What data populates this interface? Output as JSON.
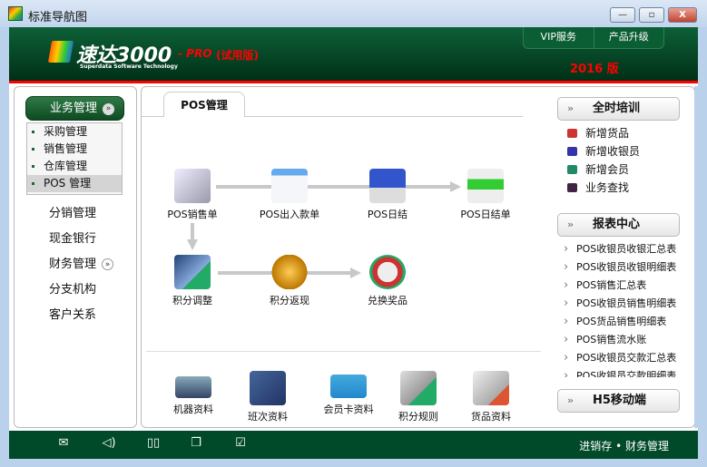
{
  "window": {
    "title": "标准导航图",
    "min": "—",
    "max": "▫",
    "close": "X"
  },
  "header": {
    "logo": "速达3000",
    "logo_sub": "Superdata Software Technology",
    "pro": "- PRO",
    "trial": "(试用版)",
    "vip": "VIP服务",
    "upgrade": "产品升级",
    "year": "2016 版"
  },
  "left": {
    "active": "业务管理",
    "sub": [
      "采购管理",
      "销售管理",
      "仓库管理",
      "POS 管理"
    ],
    "items": [
      "分销管理",
      "现金银行",
      "财务管理",
      "分支机构",
      "客户关系"
    ]
  },
  "main": {
    "tab": "POS管理",
    "flow_row1": [
      "POS销售单",
      "POS出入款单",
      "POS日结",
      "POS日结单"
    ],
    "flow_row2": [
      "积分调整",
      "积分返现",
      "兑换奖品"
    ],
    "bottom": [
      "机器资料",
      "班次资料",
      "会员卡资料",
      "积分规则",
      "货品资料"
    ]
  },
  "right": {
    "training": "全时培训",
    "quick": [
      "新增货品",
      "新增收银员",
      "新增会员",
      "业务查找"
    ],
    "reports_title": "报表中心",
    "reports": [
      "POS收银员收银汇总表",
      "POS收银员收银明细表",
      "POS销售汇总表",
      "POS收银员销售明细表",
      "POS货品销售明细表",
      "POS销售流水账",
      "POS收银员交款汇总表",
      "POS收银员交款明细表"
    ],
    "h5": "H5移动端"
  },
  "footer": {
    "text": "进销存 • 财务管理"
  },
  "colors": {
    "header": "#004a2a",
    "accent": "#ff0000"
  }
}
